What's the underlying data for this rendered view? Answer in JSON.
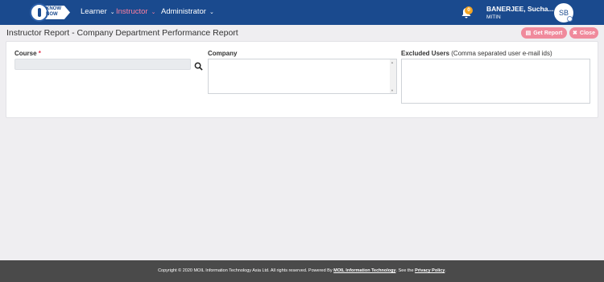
{
  "logo": {
    "line1": "KNOW",
    "line2": "NOW"
  },
  "nav": {
    "learner": "Learner",
    "instructor": "Instructor",
    "administrator": "Administrator"
  },
  "notifications": {
    "count": "0",
    "icon": "bell-icon"
  },
  "user": {
    "name": "BANERJEE, Sucha...",
    "org": "MITIN",
    "initials": "SB"
  },
  "page": {
    "title": "Instructor Report - Company Department Performance Report"
  },
  "actions": {
    "get_report": "Get Report",
    "close": "Close"
  },
  "form": {
    "course_label": "Course",
    "course_required": "*",
    "company_label": "Company",
    "excluded_label": "Excluded Users",
    "excluded_hint": "(Comma separated user e-mail ids)"
  },
  "footer": {
    "prefix": "Copyright © 2020 MOIL Information Technology Asia Ltd. All rights reserved. Powered By ",
    "company_link": "MOIL Information Technology",
    "mid": ". See the ",
    "privacy_link": "Privacy Policy",
    "suffix": "."
  },
  "colors": {
    "nav_bg": "#1a4a8e",
    "accent": "#f08a9c",
    "active_nav": "#ff7fa0",
    "footer_bg": "#4a4a4a"
  }
}
